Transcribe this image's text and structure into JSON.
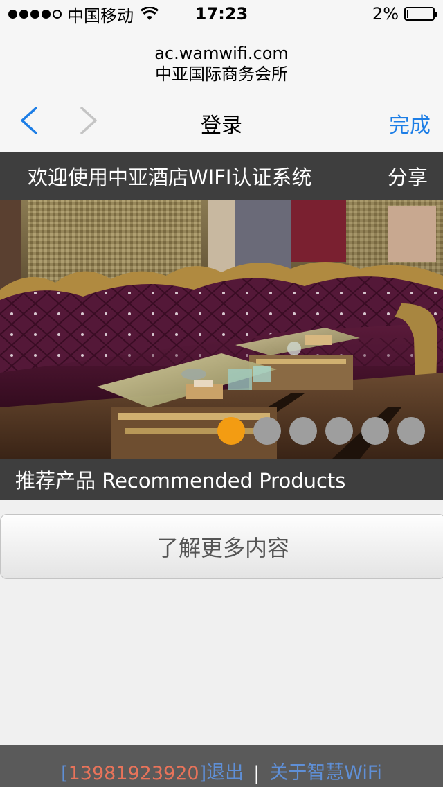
{
  "status_bar": {
    "carrier": "中国移动",
    "time": "17:23",
    "battery_percent": "2%",
    "battery_level": 0.02,
    "signal_bars_filled": 4,
    "signal_bars_total": 5
  },
  "address": {
    "url": "ac.wamwifi.com",
    "site_title": "中亚国际商务会所"
  },
  "navbar": {
    "back_icon": "chevron-left-icon",
    "forward_icon": "chevron-right-icon",
    "title": "登录",
    "done_label": "完成",
    "accent_color": "#1d7ee6"
  },
  "welcome": {
    "text": "欢迎使用中亚酒店WIFI认证系统",
    "share_label": "分享"
  },
  "banner": {
    "image": "hotel-lounge-photo",
    "slide_count": 6,
    "active_slide": 1,
    "active_dot_color": "#f39c12"
  },
  "recommended": {
    "heading": "推荐产品 Recommended Products"
  },
  "learn_more": {
    "label": "了解更多内容"
  },
  "footer": {
    "bracket_open": "[",
    "phone": "13981923920",
    "bracket_close": "]",
    "logout_label": "退出",
    "separator": "|",
    "about_label": "关于智慧WiFi"
  }
}
